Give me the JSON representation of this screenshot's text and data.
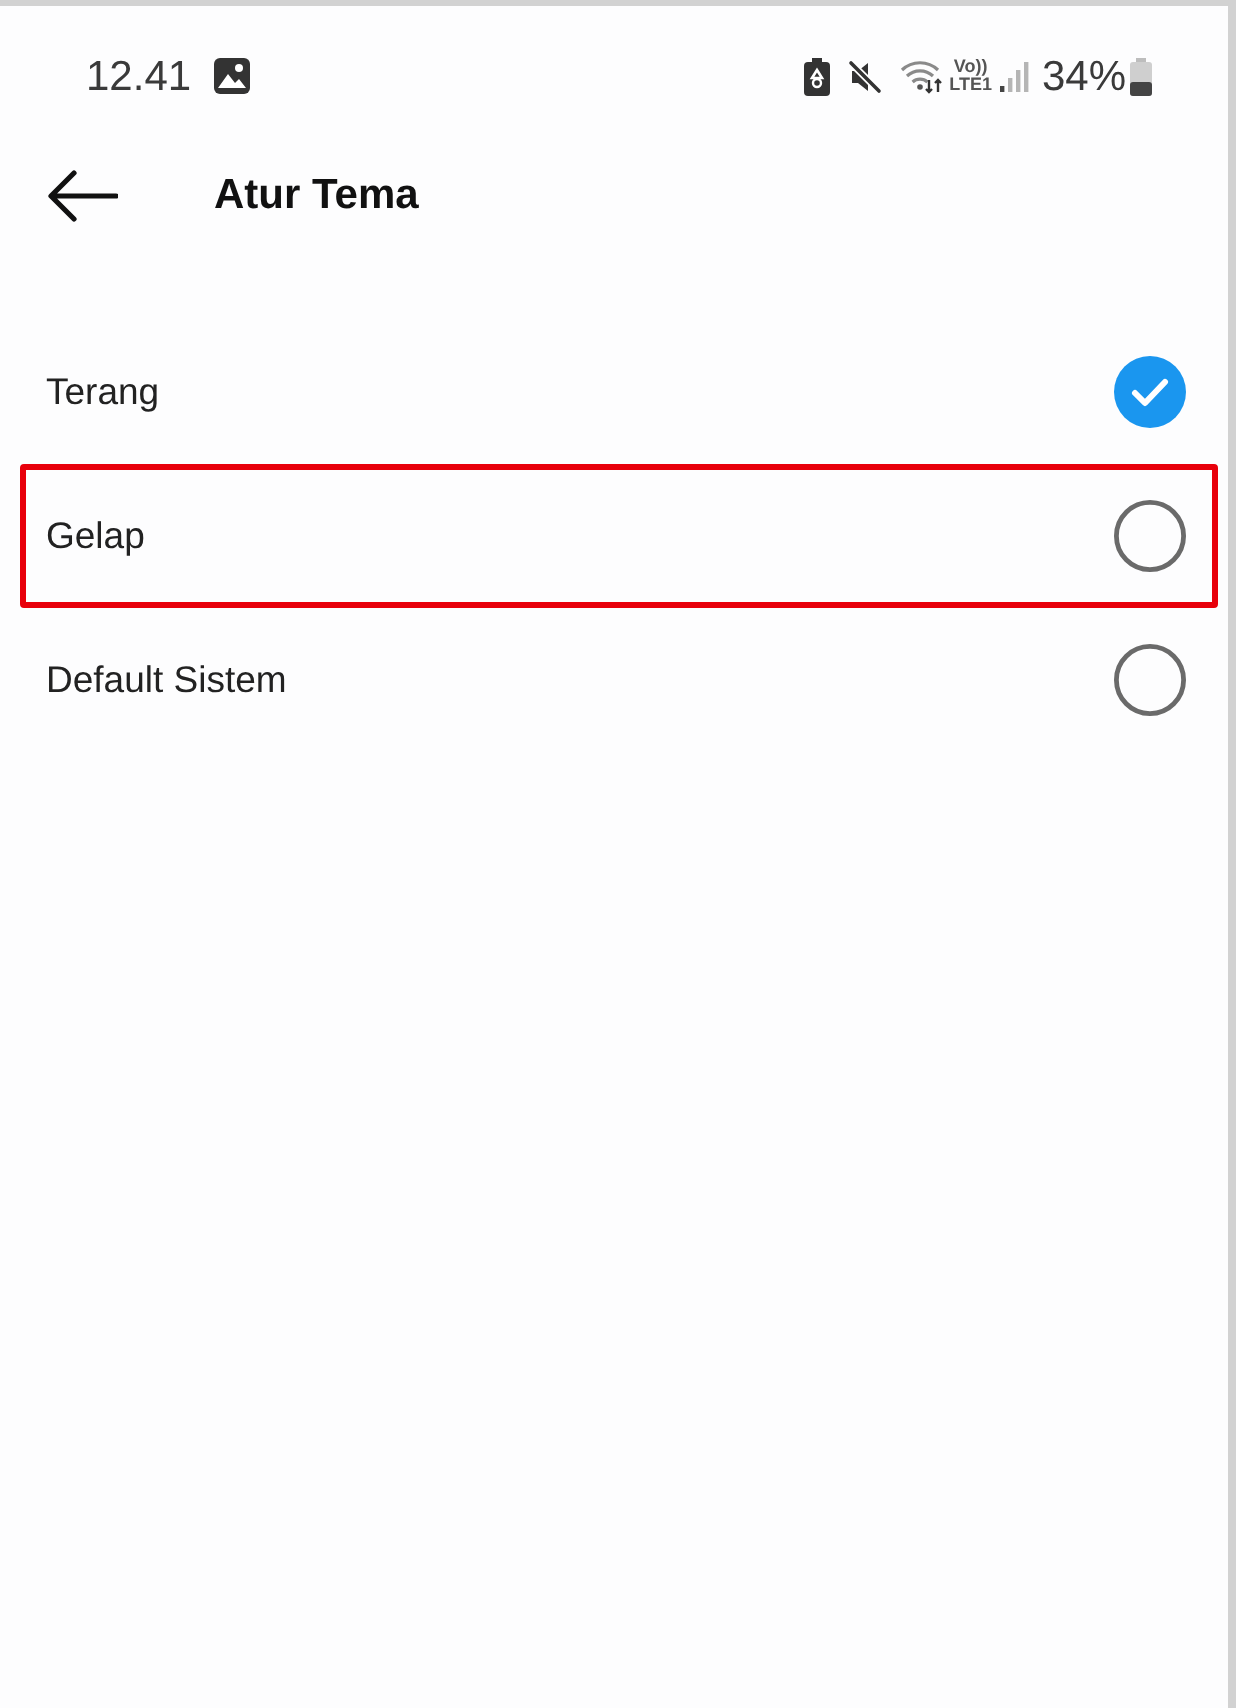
{
  "status_bar": {
    "time": "12.41",
    "network_label": [
      "Vo))",
      "LTE1"
    ],
    "battery": "34%"
  },
  "header": {
    "title": "Atur Tema"
  },
  "options": [
    {
      "label": "Terang",
      "selected": true,
      "highlighted": false
    },
    {
      "label": "Gelap",
      "selected": false,
      "highlighted": true
    },
    {
      "label": "Default Sistem",
      "selected": false,
      "highlighted": false
    }
  ]
}
